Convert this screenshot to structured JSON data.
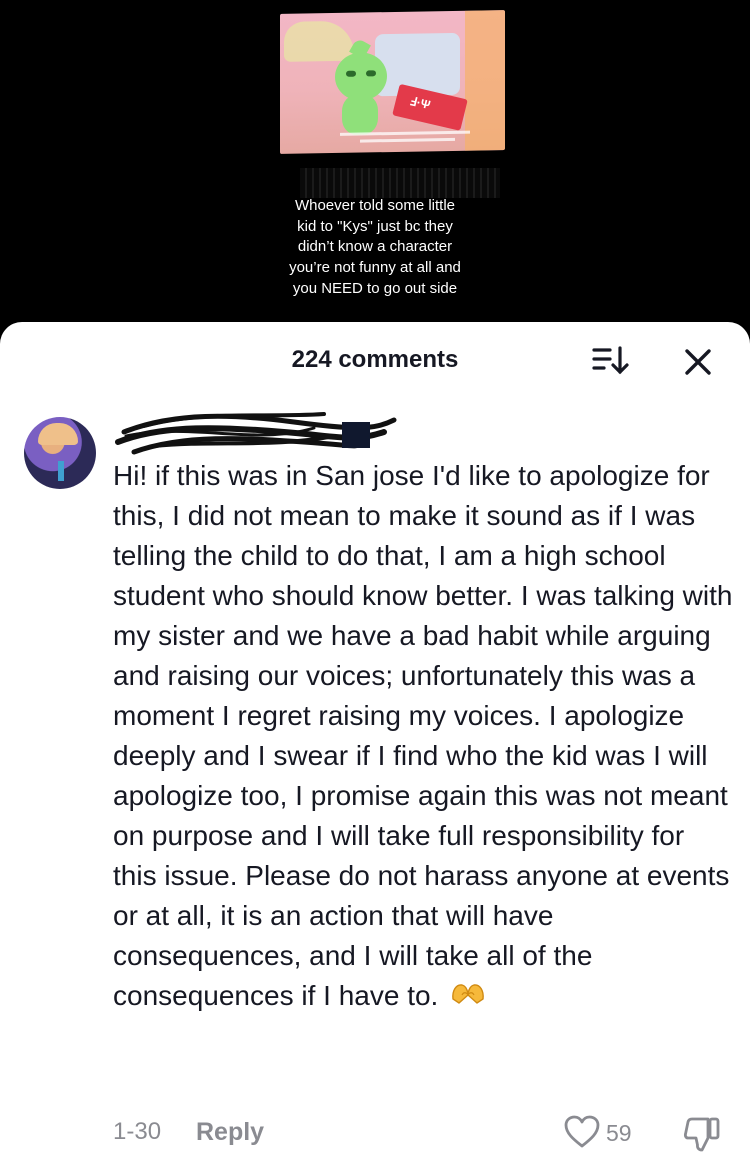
{
  "video": {
    "caption": "Whoever told some little\nkid to \"Kys\" just bc they\ndidn’t know a character\nyou’re not funny at all and\nyou NEED to go out side"
  },
  "comments_sheet": {
    "title": "224 comments",
    "icons": {
      "sort": "sort-icon",
      "close": "close-icon"
    }
  },
  "comment": {
    "username": "",
    "text": "Hi! if this was in San jose I'd like to apologize for this, I did not mean to make it sound as if I was telling the child to do that, I am a high school student who should know better. I was talking with my sister and we have a bad habit while arguing and raising our voices; unfortunately this was a moment I regret raising my voices. I apologize deeply and I swear if I find who the kid was I will apologize too, I promise again this was not meant on purpose and I will take full responsibility for this issue. Please do not harass anyone at events or at all, it is an action that will have consequences, and I will take all of the consequences if I have to.",
    "emoji": "heart-hands-emoji",
    "date": "1-30",
    "reply_label": "Reply",
    "like_count": "59",
    "icons": {
      "like": "heart-outline-icon",
      "dislike": "thumbs-down-icon"
    }
  }
}
